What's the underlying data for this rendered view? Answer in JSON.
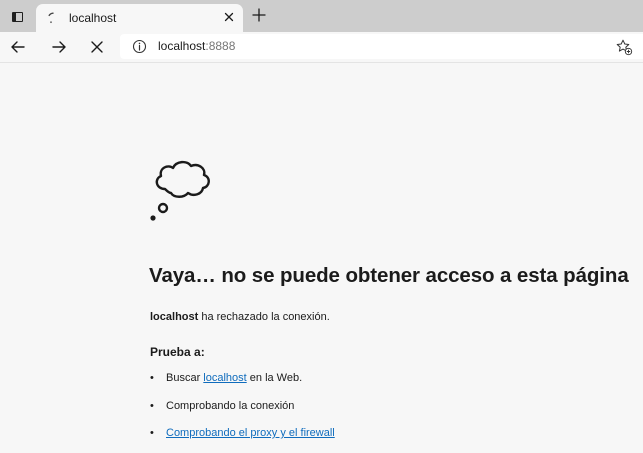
{
  "tab": {
    "title": "localhost",
    "spinner_icon": "loading-spinner-icon",
    "close_icon": "close-icon"
  },
  "toolbar": {
    "url_host": "localhost",
    "url_port": ":8888",
    "back_icon": "arrow-left-icon",
    "forward_icon": "arrow-right-icon",
    "stop_icon": "close-icon",
    "info_icon": "info-icon",
    "favorite_icon": "star-add-icon"
  },
  "error": {
    "icon": "thought-cloud-icon",
    "heading": "Vaya… no se puede obtener acceso a esta página",
    "reason_host": "localhost",
    "reason_text": " ha rechazado la conexión.",
    "try_title": "Prueba a:",
    "suggestion1_prefix": "Buscar ",
    "suggestion1_link": "localhost",
    "suggestion1_suffix": " en la Web.",
    "suggestion2": "Comprobando la conexión",
    "suggestion3_link": "Comprobando el proxy y el firewall"
  },
  "colors": {
    "tabstrip": "#cdcdcd",
    "page_bg": "#f7f7f7",
    "link": "#0f6cbd"
  }
}
